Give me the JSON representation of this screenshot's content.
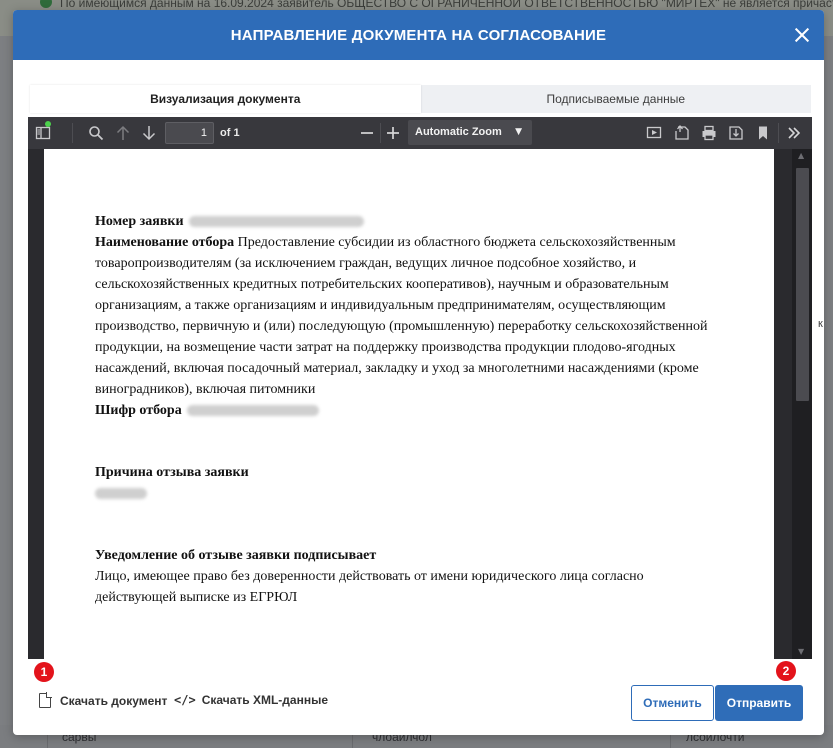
{
  "background": {
    "notice": "По имеющимся данным на 16.09.2024 заявитель ОБЩЕСТВО С ОГРАНИЧЕННОЙ ОТВЕТСТВЕННОСТЬЮ \"МИРТЕХ\" не является причастным к...",
    "bottom_cells": [
      "сарвы",
      "члоаилчол",
      "лсоилочти"
    ]
  },
  "modal": {
    "title": "НАПРАВЛЕНИЕ ДОКУМЕНТА НА СОГЛАСОВАНИЕ",
    "tabs": [
      {
        "label": "Визуализация документа",
        "active": true
      },
      {
        "label": "Подписываемые данные",
        "active": false
      }
    ]
  },
  "viewer": {
    "page_number": "1",
    "page_count": "of 1",
    "zoom": "Automatic Zoom",
    "icons": {
      "sidebar": "sidebar-toggle-icon",
      "search": "search-icon",
      "prev": "arrow-up-icon",
      "next": "arrow-down-icon",
      "zoom_out": "minus-icon",
      "zoom_in": "plus-icon",
      "presentation": "presentation-icon",
      "open": "open-file-icon",
      "print": "print-icon",
      "download": "download-icon",
      "bookmark": "bookmark-icon",
      "more": "double-chevron-icon"
    }
  },
  "document": {
    "request_number_label": "Номер заявки",
    "selection_name_label": "Наименование отбора",
    "selection_name_lines": [
      "Предоставление субсидии из областного бюджета сельскохозяйственным",
      "товаропроизводителям (за исключением граждан, ведущих личное подсобное хозяйство, и",
      "сельскохозяйственных кредитных потребительских кооперативов), научным и образовательным",
      "организациям, а также организациям и индивидуальным предпринимателям, осуществляющим",
      "производство, первичную и (или) последующую (промышленную) переработку сельскохозяйственной",
      "продукции, на возмещение части затрат на поддержку производства продукции плодово-ягодных",
      "насаждений, включая посадочный материал, закладку и уход за многолетними насаждениями (кроме",
      "виноградников), включая питомники"
    ],
    "selection_code_label": "Шифр отбора",
    "withdraw_reason_label": "Причина отзыва заявки",
    "signer_label": "Уведомление об отзыве заявки подписывает",
    "signer_lines": [
      "Лицо, имеющее право без доверенности действовать от имени юридического лица согласно",
      "действующей выписке из ЕГРЮЛ"
    ]
  },
  "footer": {
    "download_document": "Скачать документ",
    "download_xml": "Скачать XML-данные",
    "cancel": "Отменить",
    "send": "Отправить",
    "badge_left": "1",
    "badge_right": "2"
  },
  "colors": {
    "header": "#2e6cb8",
    "primary_button": "#2f6db8",
    "badge": "#e3131b",
    "viewer_toolbar": "#38383d"
  }
}
